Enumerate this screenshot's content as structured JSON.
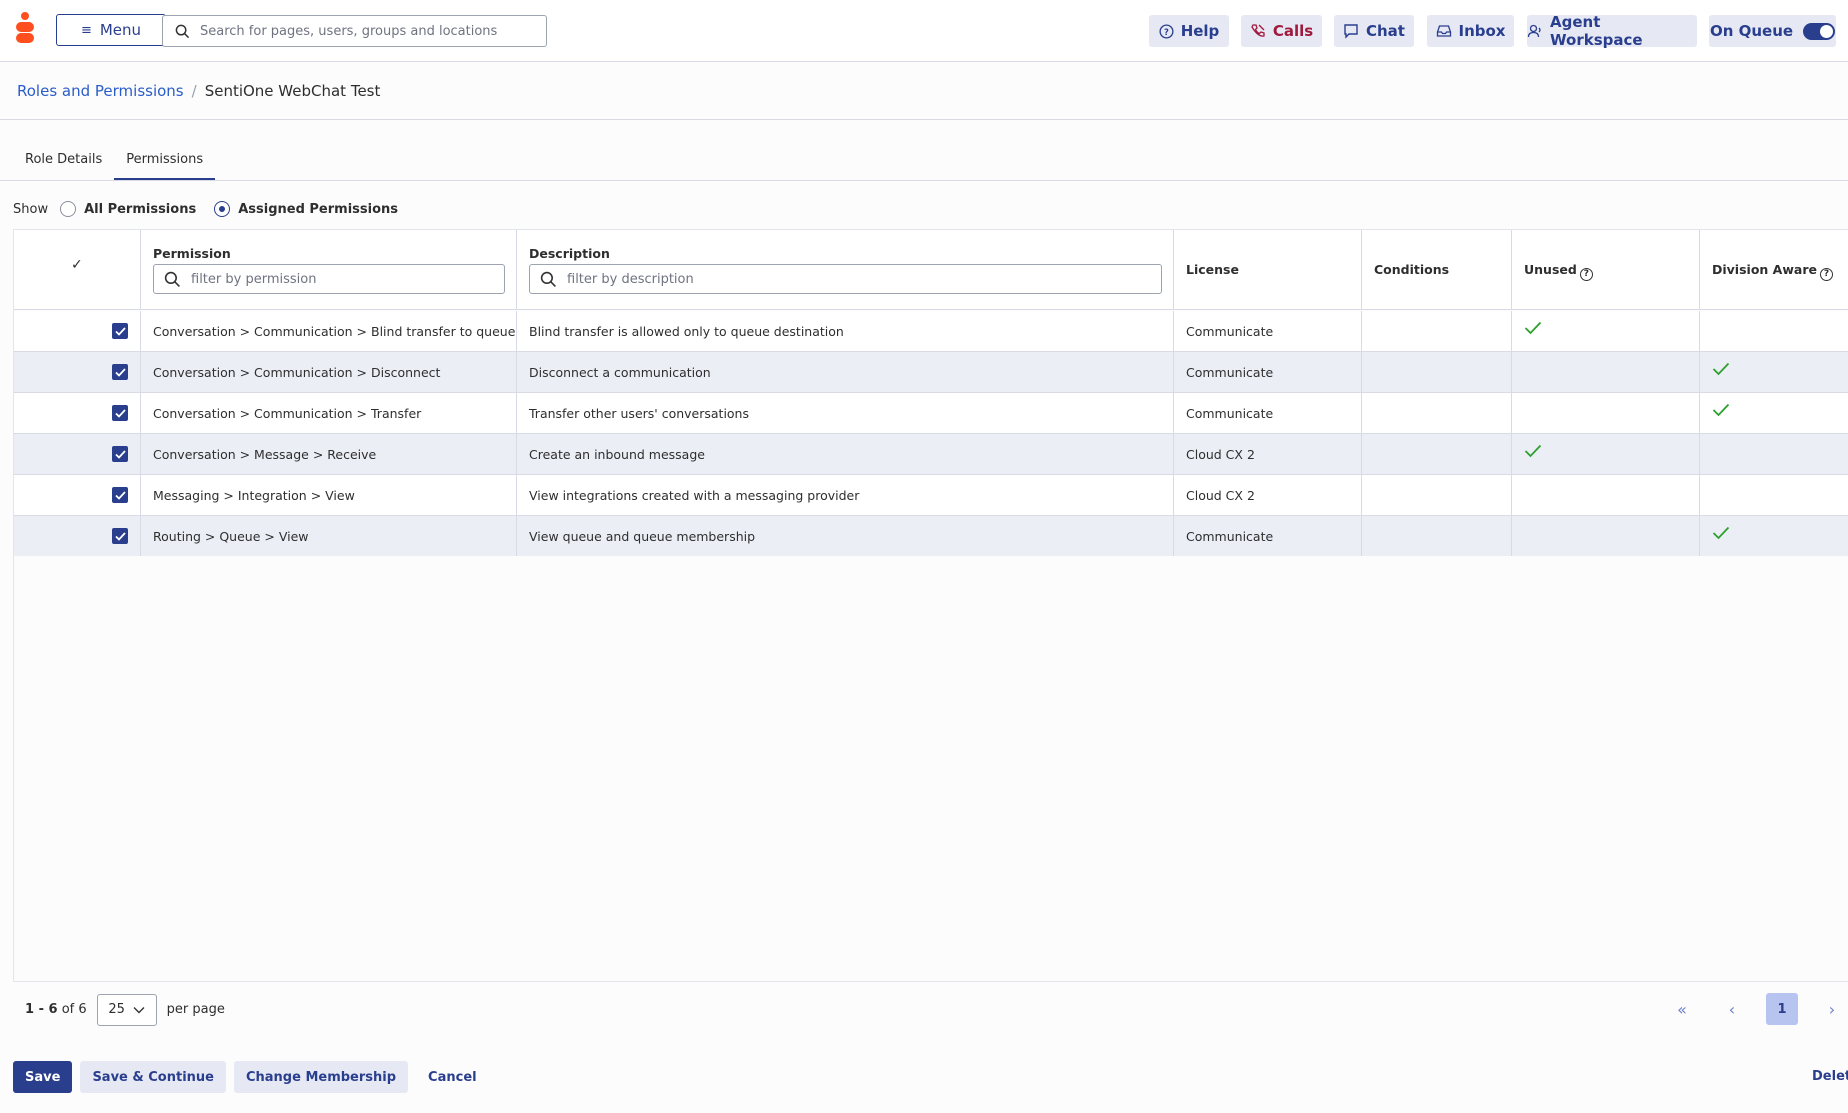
{
  "topbar": {
    "menu_label": "Menu",
    "search_placeholder": "Search for pages, users, groups and locations",
    "help": "Help",
    "calls": "Calls",
    "chat": "Chat",
    "inbox": "Inbox",
    "agent_workspace": "Agent Workspace",
    "on_queue": "On Queue",
    "on_queue_state": true
  },
  "breadcrumb": {
    "parent": "Roles and Permissions",
    "separator": "/",
    "current": "SentiOne WebChat Test"
  },
  "tabs": [
    {
      "label": "Role Details",
      "active": false
    },
    {
      "label": "Permissions",
      "active": true
    }
  ],
  "show": {
    "label": "Show",
    "options": [
      {
        "label": "All Permissions",
        "selected": false
      },
      {
        "label": "Assigned Permissions",
        "selected": true
      }
    ]
  },
  "table": {
    "select_all_mark": "✓",
    "headers": {
      "permission": "Permission",
      "permission_filter_placeholder": "filter by permission",
      "description": "Description",
      "description_filter_placeholder": "filter by description",
      "license": "License",
      "conditions": "Conditions",
      "unused": "Unused",
      "division_aware": "Division Aware"
    },
    "rows": [
      {
        "checked": true,
        "permission": "Conversation > Communication > Blind transfer to queue",
        "description": "Blind transfer is allowed only to queue destination",
        "license": "Communicate",
        "conditions": "",
        "unused": true,
        "division_aware": false
      },
      {
        "checked": true,
        "permission": "Conversation > Communication > Disconnect",
        "description": "Disconnect a communication",
        "license": "Communicate",
        "conditions": "",
        "unused": false,
        "division_aware": true
      },
      {
        "checked": true,
        "permission": "Conversation > Communication > Transfer",
        "description": "Transfer other users' conversations",
        "license": "Communicate",
        "conditions": "",
        "unused": false,
        "division_aware": true
      },
      {
        "checked": true,
        "permission": "Conversation > Message > Receive",
        "description": "Create an inbound message",
        "license": "Cloud CX 2",
        "conditions": "",
        "unused": true,
        "division_aware": false
      },
      {
        "checked": true,
        "permission": "Messaging > Integration > View",
        "description": "View integrations created with a messaging provider",
        "license": "Cloud CX 2",
        "conditions": "",
        "unused": false,
        "division_aware": false
      },
      {
        "checked": true,
        "permission": "Routing > Queue > View",
        "description": "View queue and queue membership",
        "license": "Communicate",
        "conditions": "",
        "unused": false,
        "division_aware": true
      }
    ]
  },
  "pagination": {
    "range": "1 - 6",
    "of_text": "of 6",
    "per_page_value": "25",
    "per_page_label": "per page",
    "current_page": "1"
  },
  "actions": {
    "save": "Save",
    "save_continue": "Save & Continue",
    "change_membership": "Change Membership",
    "cancel": "Cancel",
    "delete": "Delete"
  },
  "colors": {
    "accent": "#2a3e8e",
    "brand": "#ff4f1f",
    "check": "#2ba12b",
    "row_alt": "#eceef6"
  }
}
